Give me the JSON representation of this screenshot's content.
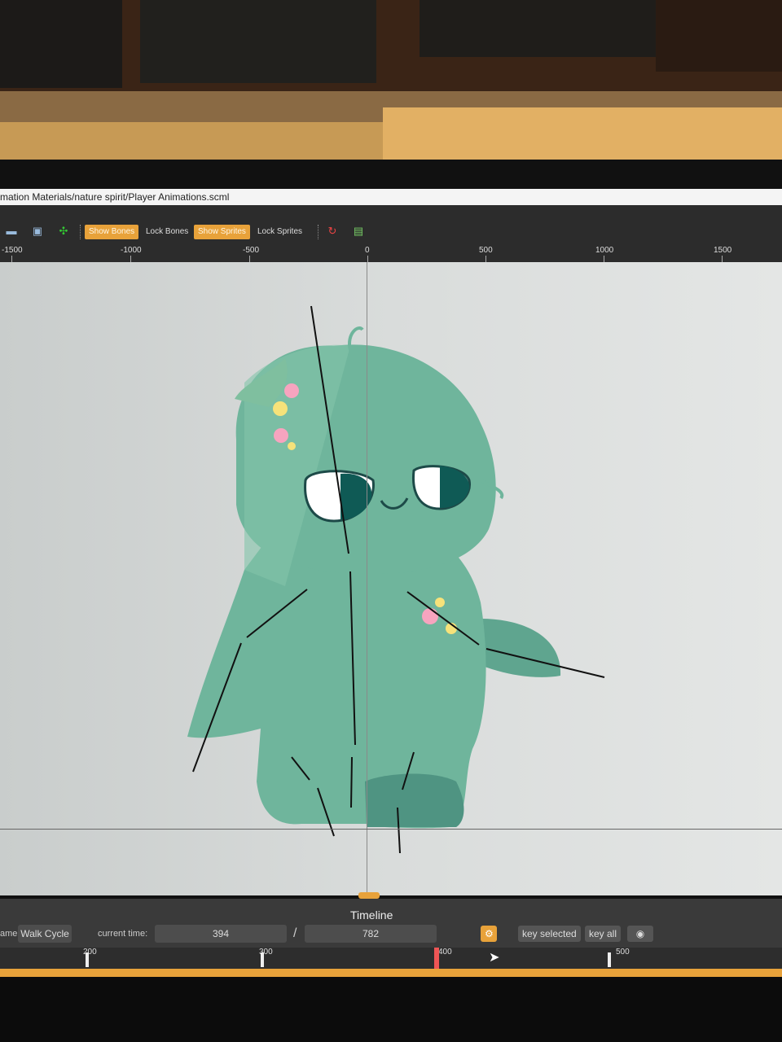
{
  "window": {
    "title": "mation Materials/nature spirit/Player Animations.scml"
  },
  "toolbar": {
    "show_bones": "Show Bones",
    "lock_bones": "Lock Bones",
    "show_sprites": "Show Sprites",
    "lock_sprites": "Lock Sprites"
  },
  "ruler": {
    "labels": [
      "-1500",
      "-1000",
      "-500",
      "0",
      "500",
      "1000",
      "1500"
    ]
  },
  "timeline": {
    "title": "Timeline",
    "name_label": "ame",
    "animation_name": "Walk Cycle",
    "current_time_label": "current time:",
    "current_time": "394",
    "separator": "/",
    "total_time": "782",
    "key_selected": "key selected",
    "key_all": "key all",
    "tick_labels": [
      "200",
      "300",
      "400",
      "500"
    ]
  },
  "colors": {
    "accent": "#e8a23a",
    "character": "#6fb59c",
    "canvas": "#d8dbda",
    "panel": "#2c2c2c"
  },
  "icons": {
    "folder": "folder-icon",
    "screen": "screen-icon",
    "fit": "fit-view-icon",
    "flip": "flip-icon",
    "image": "image-icon",
    "settings": "settings-icon",
    "sound": "sound-icon"
  }
}
